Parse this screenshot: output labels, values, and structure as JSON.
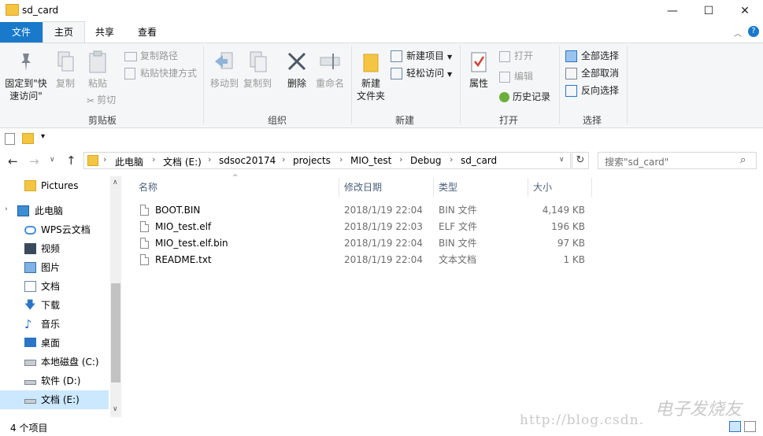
{
  "window": {
    "title": "sd_card",
    "minimize": "—",
    "maximize": "☐",
    "close": "✕"
  },
  "tabs": [
    {
      "label": "文件"
    },
    {
      "label": "主页"
    },
    {
      "label": "共享"
    },
    {
      "label": "查看"
    }
  ],
  "ribbon": {
    "clipboard": {
      "label": "剪贴板",
      "pin_line1": "固定到\"快",
      "pin_line2": "速访问\"",
      "copy": "复制",
      "paste": "粘贴",
      "copy_path": "复制路径",
      "paste_shortcut": "粘贴快捷方式",
      "cut": "剪切"
    },
    "organize": {
      "label": "组织",
      "move_to": "移动到",
      "copy_to": "复制到",
      "delete": "删除",
      "rename": "重命名"
    },
    "new": {
      "label": "新建",
      "new_folder_line1": "新建",
      "new_folder_line2": "文件夹",
      "new_item": "新建项目",
      "easy_access": "轻松访问"
    },
    "open": {
      "label": "打开",
      "properties": "属性",
      "open": "打开",
      "edit": "编辑",
      "history": "历史记录"
    },
    "select": {
      "label": "选择",
      "select_all": "全部选择",
      "select_none": "全部取消",
      "invert": "反向选择"
    }
  },
  "address": {
    "crumbs": [
      "此电脑",
      "文档 (E:)",
      "sdsoc20174",
      "projects",
      "MIO_test",
      "Debug",
      "sd_card"
    ],
    "search_placeholder": "搜索\"sd_card\""
  },
  "nav": [
    {
      "label": "Pictures",
      "icon": "folder-icon"
    },
    {
      "label": "此电脑",
      "icon": "computer-icon"
    },
    {
      "label": "WPS云文档",
      "icon": "cloud-icon"
    },
    {
      "label": "视频",
      "icon": "video-icon"
    },
    {
      "label": "图片",
      "icon": "picture-icon"
    },
    {
      "label": "文档",
      "icon": "document-icon"
    },
    {
      "label": "下载",
      "icon": "download-icon"
    },
    {
      "label": "音乐",
      "icon": "music-icon"
    },
    {
      "label": "桌面",
      "icon": "desktop-icon"
    },
    {
      "label": "本地磁盘 (C:)",
      "icon": "drive-icon"
    },
    {
      "label": "软件 (D:)",
      "icon": "drive-icon"
    },
    {
      "label": "文档 (E:)",
      "icon": "drive-icon"
    }
  ],
  "columns": {
    "name": "名称",
    "modified": "修改日期",
    "type": "类型",
    "size": "大小"
  },
  "files": [
    {
      "name": "BOOT.BIN",
      "modified": "2018/1/19 22:04",
      "type": "BIN 文件",
      "size": "4,149 KB"
    },
    {
      "name": "MIO_test.elf",
      "modified": "2018/1/19 22:03",
      "type": "ELF 文件",
      "size": "196 KB"
    },
    {
      "name": "MIO_test.elf.bin",
      "modified": "2018/1/19 22:04",
      "type": "BIN 文件",
      "size": "97 KB"
    },
    {
      "name": "README.txt",
      "modified": "2018/1/19 22:04",
      "type": "文本文档",
      "size": "1 KB"
    }
  ],
  "status": {
    "count": "4 个项目"
  },
  "watermark": {
    "url": "http://blog.csdn.",
    "brand": "电子发烧友"
  },
  "colors": {
    "accent": "#1979ca",
    "folder": "#f4c542",
    "selected": "#cce8ff"
  }
}
